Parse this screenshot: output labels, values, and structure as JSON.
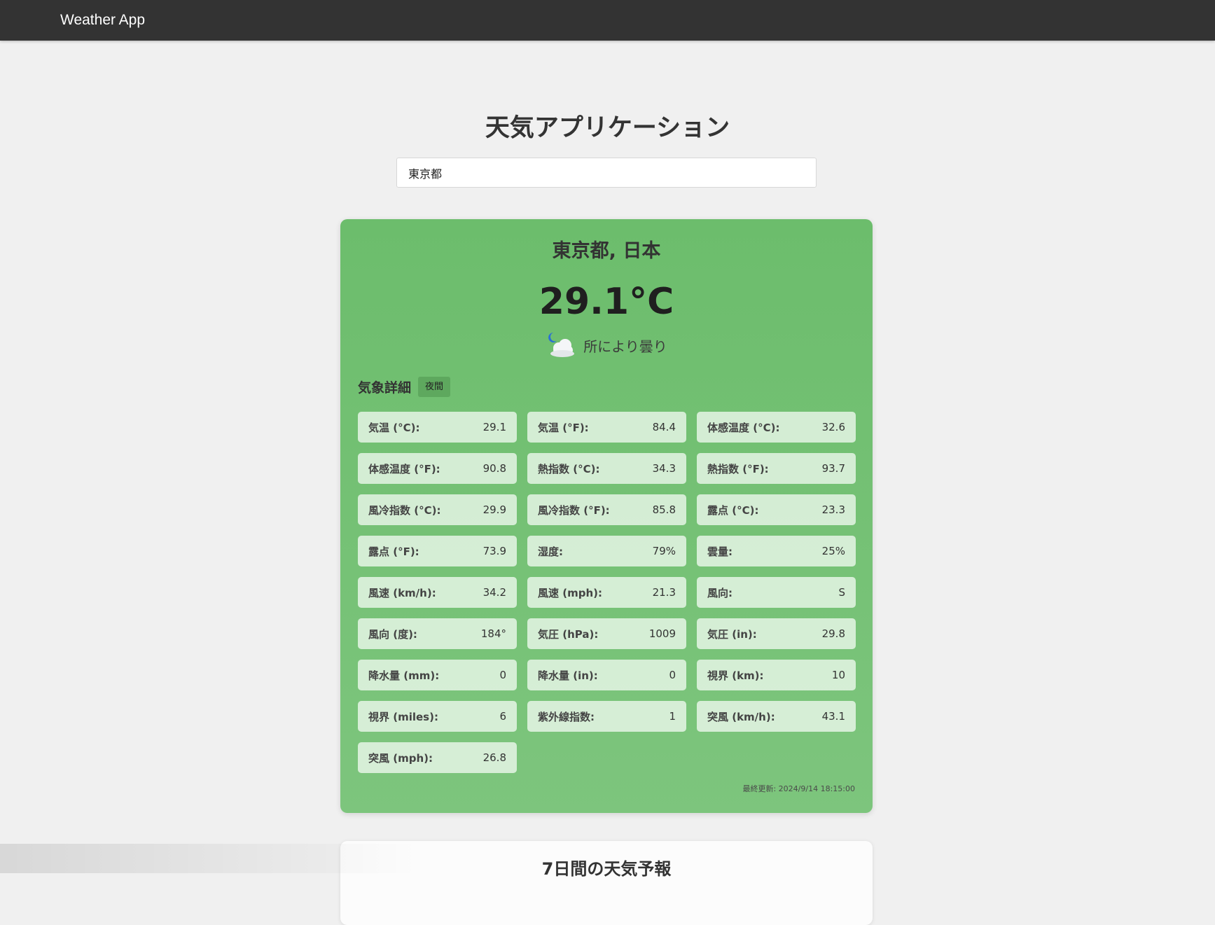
{
  "app": {
    "brand": "Weather App",
    "title": "天気アプリケーション"
  },
  "search": {
    "value": "東京都",
    "placeholder": ""
  },
  "current": {
    "location": "東京都, 日本",
    "temperature": "29.1°C",
    "condition": "所により曇り",
    "condition_icon": "partly-cloudy-night-icon",
    "details_title": "気象詳細",
    "day_badge": "夜間",
    "last_updated": "最終更新: 2024/9/14 18:15:00",
    "card_color": "#6cbd6c"
  },
  "details": [
    {
      "label": "気温 (°C):",
      "value": "29.1"
    },
    {
      "label": "気温 (°F):",
      "value": "84.4"
    },
    {
      "label": "体感温度 (°C):",
      "value": "32.6"
    },
    {
      "label": "体感温度 (°F):",
      "value": "90.8"
    },
    {
      "label": "熱指数 (°C):",
      "value": "34.3"
    },
    {
      "label": "熱指数 (°F):",
      "value": "93.7"
    },
    {
      "label": "風冷指数 (°C):",
      "value": "29.9"
    },
    {
      "label": "風冷指数 (°F):",
      "value": "85.8"
    },
    {
      "label": "露点 (°C):",
      "value": "23.3"
    },
    {
      "label": "露点 (°F):",
      "value": "73.9"
    },
    {
      "label": "湿度:",
      "value": "79%"
    },
    {
      "label": "雲量:",
      "value": "25%"
    },
    {
      "label": "風速 (km/h):",
      "value": "34.2"
    },
    {
      "label": "風速 (mph):",
      "value": "21.3"
    },
    {
      "label": "風向:",
      "value": "S"
    },
    {
      "label": "風向 (度):",
      "value": "184°"
    },
    {
      "label": "気圧 (hPa):",
      "value": "1009"
    },
    {
      "label": "気圧 (in):",
      "value": "29.8"
    },
    {
      "label": "降水量 (mm):",
      "value": "0"
    },
    {
      "label": "降水量 (in):",
      "value": "0"
    },
    {
      "label": "視界 (km):",
      "value": "10"
    },
    {
      "label": "視界 (miles):",
      "value": "6"
    },
    {
      "label": "紫外線指数:",
      "value": "1"
    },
    {
      "label": "突風 (km/h):",
      "value": "43.1"
    },
    {
      "label": "突風 (mph):",
      "value": "26.8"
    }
  ],
  "forecast": {
    "title": "7日間の天気予報"
  }
}
